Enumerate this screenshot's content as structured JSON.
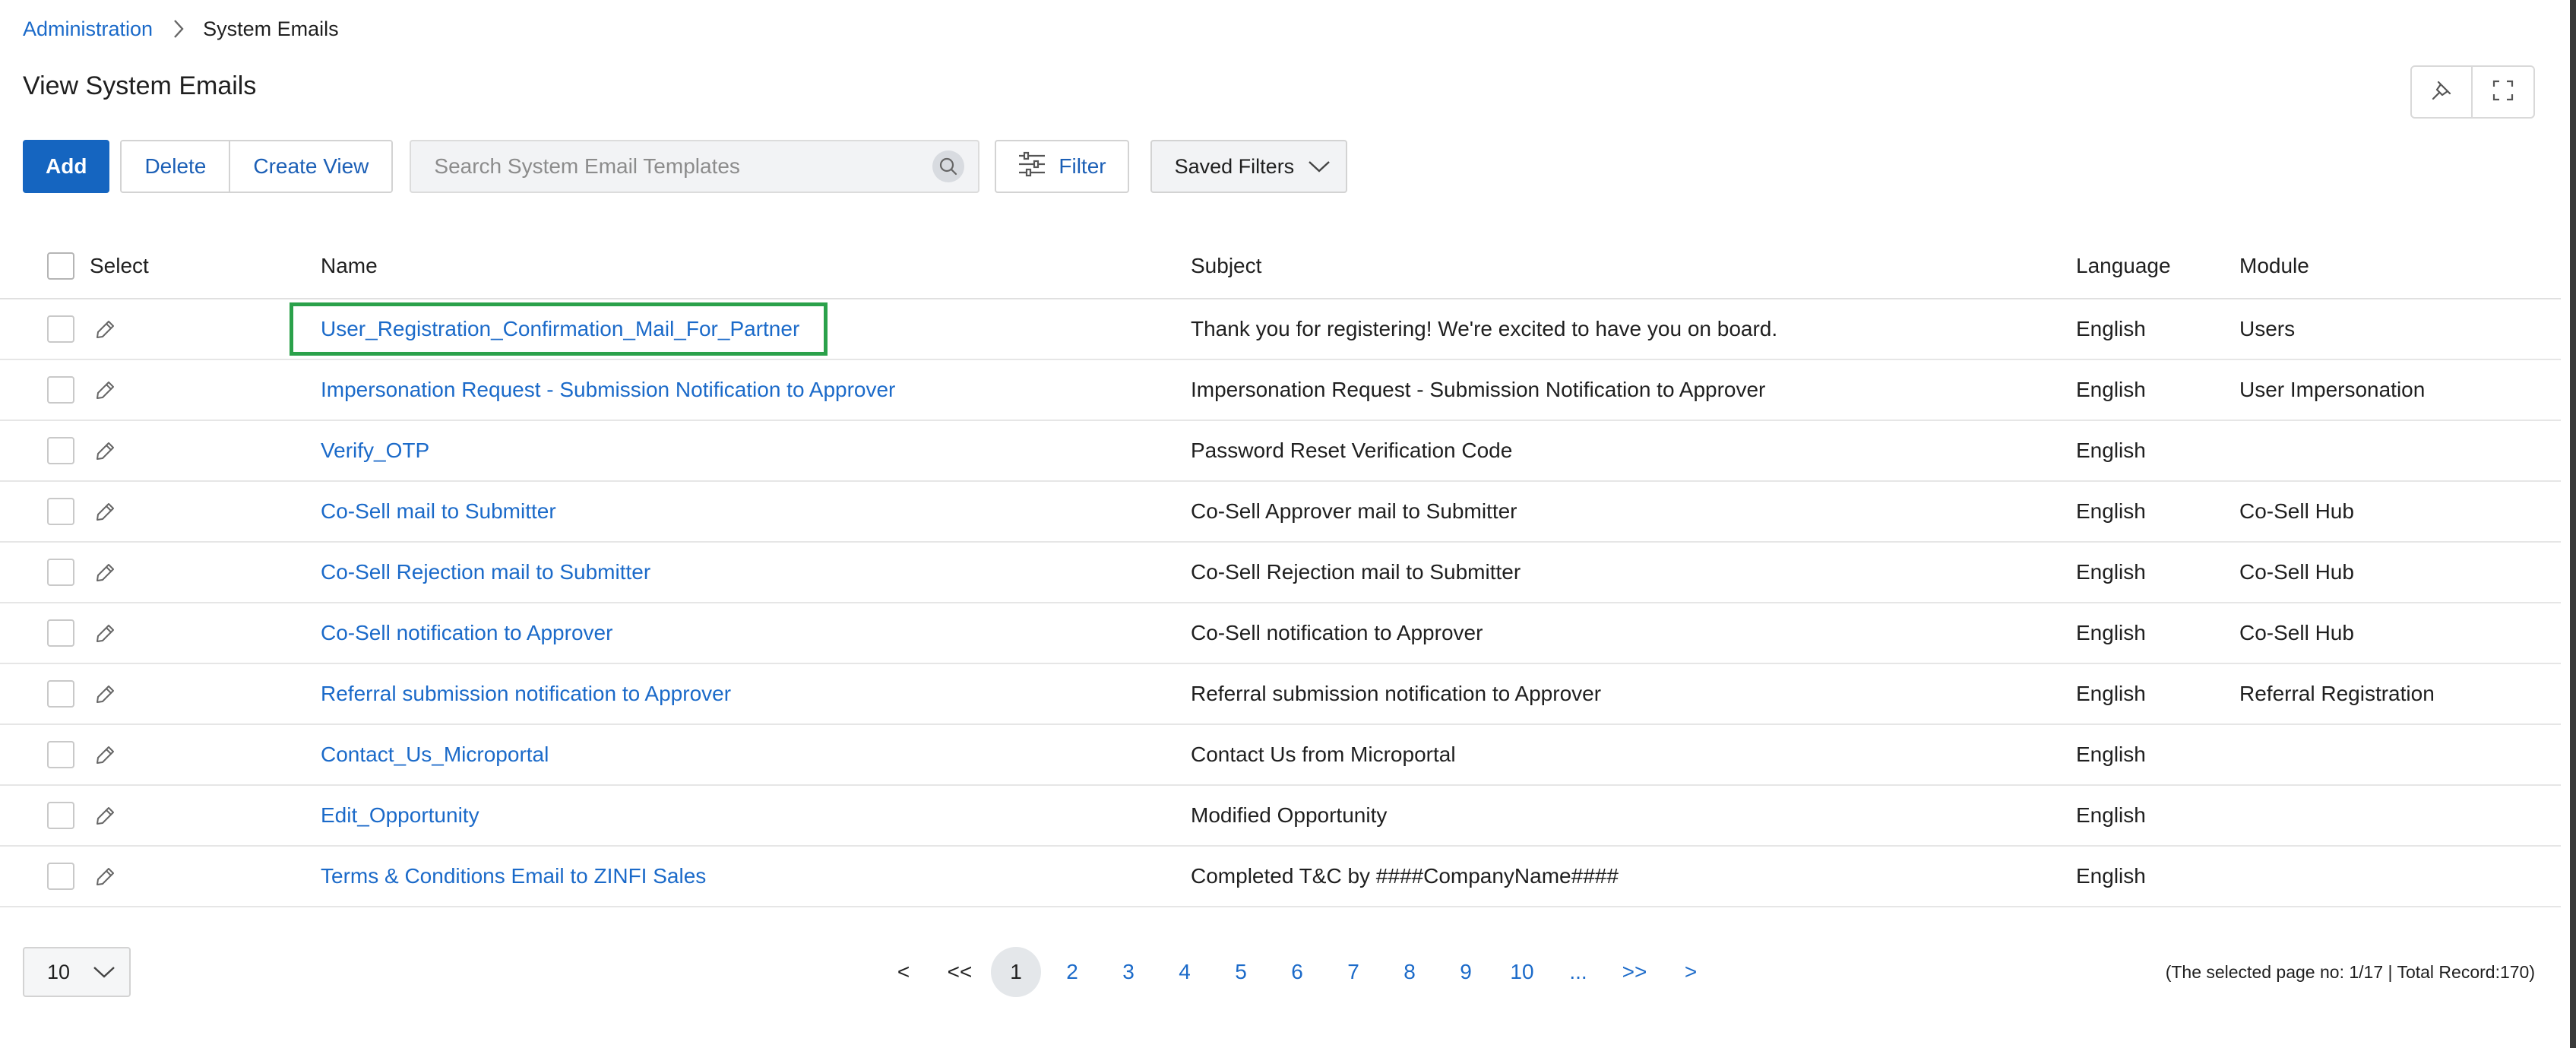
{
  "breadcrumb": {
    "root": "Administration",
    "current": "System Emails"
  },
  "page": {
    "title": "View System Emails"
  },
  "toolbar": {
    "add_label": "Add",
    "delete_label": "Delete",
    "create_view_label": "Create View",
    "search_placeholder": "Search System Email Templates",
    "filter_label": "Filter",
    "saved_filters_label": "Saved Filters"
  },
  "table": {
    "columns": {
      "select": "Select",
      "name": "Name",
      "subject": "Subject",
      "language": "Language",
      "module": "Module"
    },
    "rows": [
      {
        "name": "User_Registration_Confirmation_Mail_For_Partner",
        "subject": "Thank you for registering! We're excited to have you on board.",
        "language": "English",
        "module": "Users"
      },
      {
        "name": "Impersonation Request - Submission Notification to Approver",
        "subject": "Impersonation Request - Submission Notification to Approver",
        "language": "English",
        "module": "User Impersonation"
      },
      {
        "name": "Verify_OTP",
        "subject": "Password Reset Verification Code",
        "language": "English",
        "module": ""
      },
      {
        "name": "Co-Sell mail to Submitter",
        "subject": "Co-Sell Approver mail to Submitter",
        "language": "English",
        "module": "Co-Sell Hub"
      },
      {
        "name": "Co-Sell Rejection mail to Submitter",
        "subject": "Co-Sell Rejection mail to Submitter",
        "language": "English",
        "module": "Co-Sell Hub"
      },
      {
        "name": "Co-Sell notification to Approver",
        "subject": "Co-Sell notification to Approver",
        "language": "English",
        "module": "Co-Sell Hub"
      },
      {
        "name": "Referral submission notification to Approver",
        "subject": "Referral submission notification to Approver",
        "language": "English",
        "module": "Referral Registration"
      },
      {
        "name": "Contact_Us_Microportal",
        "subject": "Contact Us from Microportal",
        "language": "English",
        "module": ""
      },
      {
        "name": "Edit_Opportunity",
        "subject": "Modified Opportunity",
        "language": "English",
        "module": ""
      },
      {
        "name": "Terms & Conditions Email to ZINFI Sales",
        "subject": "Completed T&C by ####CompanyName####",
        "language": "English",
        "module": ""
      }
    ]
  },
  "pagination": {
    "page_size": "10",
    "prev": "<",
    "first": "<<",
    "pages": [
      "1",
      "2",
      "3",
      "4",
      "5",
      "6",
      "7",
      "8",
      "9",
      "10"
    ],
    "ellipsis": "...",
    "last": ">>",
    "next": ">",
    "current_page": "1",
    "record_info": "(The selected page no: 1/17 | Total Record:170)"
  },
  "colors": {
    "accent": "#1565c0",
    "link": "#1b6ac9",
    "highlight": "#2aa14a"
  },
  "icons": {
    "breadcrumb_sep": "chevron-right-icon",
    "pin": "pin-icon",
    "fullscreen": "fullscreen-icon",
    "search": "search-icon",
    "filter": "sliders-icon",
    "dropdown": "chevron-down-icon",
    "edit": "pencil-icon"
  }
}
